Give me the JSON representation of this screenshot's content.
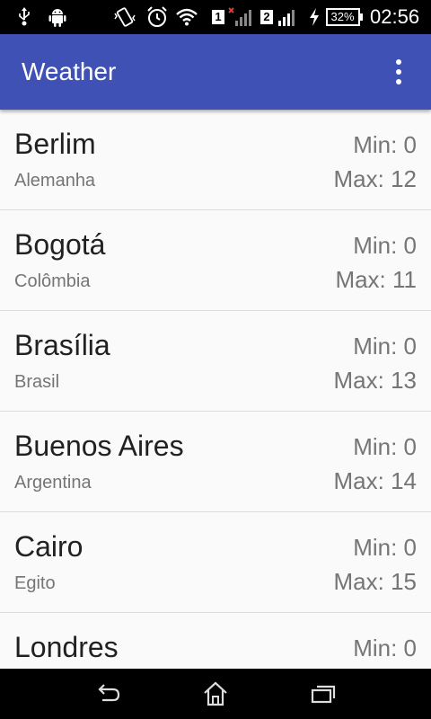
{
  "status_bar": {
    "sim1_label": "1",
    "sim2_label": "2",
    "battery": "32%",
    "time": "02:56",
    "icons": [
      "usb-icon",
      "android-icon",
      "vibrate-icon",
      "alarm-icon",
      "wifi-icon",
      "sim1-signal-icon",
      "sim2-signal-icon",
      "charging-icon",
      "battery-icon"
    ]
  },
  "app_bar": {
    "title": "Weather",
    "menu_icon": "overflow-menu-icon"
  },
  "cities": [
    {
      "name": "Berlim",
      "country": "Alemanha",
      "min": "Min: 0",
      "max": "Max: 12"
    },
    {
      "name": "Bogotá",
      "country": "Colômbia",
      "min": "Min: 0",
      "max": "Max: 11"
    },
    {
      "name": "Brasília",
      "country": "Brasil",
      "min": "Min: 0",
      "max": "Max: 13"
    },
    {
      "name": "Buenos Aires",
      "country": "Argentina",
      "min": "Min: 0",
      "max": "Max: 14"
    },
    {
      "name": "Cairo",
      "country": "Egito",
      "min": "Min: 0",
      "max": "Max: 15"
    },
    {
      "name": "Londres",
      "country": "",
      "min": "Min: 0",
      "max": ""
    }
  ],
  "nav_bar": {
    "icons": [
      "back-icon",
      "home-icon",
      "recent-apps-icon"
    ]
  },
  "colors": {
    "primary": "#3f51b5",
    "status_bar": "#000000",
    "background": "#fafafa",
    "secondary_text": "#757575"
  }
}
